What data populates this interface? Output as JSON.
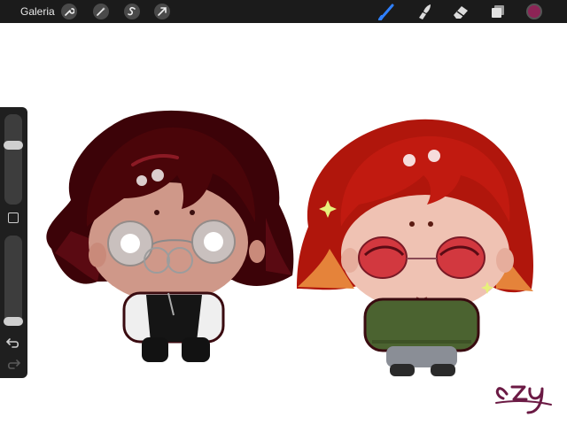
{
  "toolbar": {
    "gallery_label": "Galeria",
    "left_tools": [
      "wrench-icon",
      "magic-wand-icon",
      "selection-icon",
      "transform-arrow-icon"
    ],
    "right_tools": [
      "brush-icon",
      "smudge-icon",
      "eraser-icon",
      "layers-icon"
    ],
    "current_color": "#8d2456"
  },
  "sidebar": {
    "brush_size_level": 0.67,
    "opacity_level": 0.0
  },
  "canvas": {
    "signature": "czy"
  }
}
